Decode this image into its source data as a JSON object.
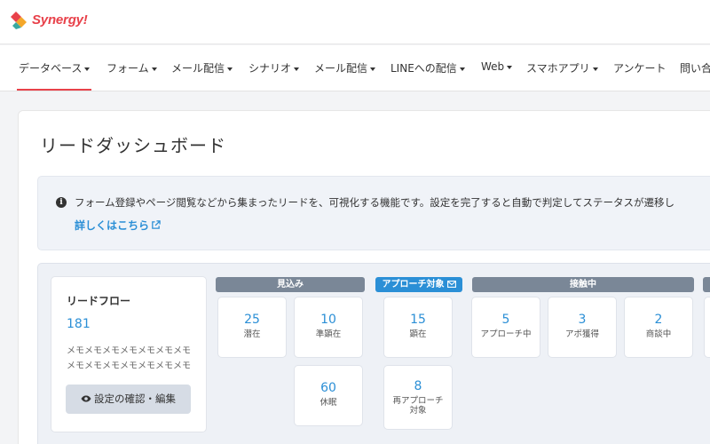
{
  "app": {
    "logo_text": "Synergy!"
  },
  "nav": {
    "items": [
      {
        "label": "データベース",
        "has_caret": true,
        "active": true
      },
      {
        "label": "フォーム",
        "has_caret": true
      },
      {
        "label": "メール配信",
        "has_caret": true
      },
      {
        "label": "シナリオ",
        "has_caret": true
      },
      {
        "label": "メール配信",
        "has_caret": true
      },
      {
        "label": "LINEへの配信",
        "has_caret": true
      },
      {
        "label": "Web",
        "has_caret": true
      },
      {
        "label": "スマホアプリ",
        "has_caret": true
      },
      {
        "label": "アンケート",
        "has_caret": false
      },
      {
        "label": "問い合",
        "has_caret": false
      }
    ]
  },
  "page": {
    "title": "リードダッシュボード"
  },
  "info": {
    "icon": "info-icon",
    "text": "フォーム登録やページ閲覧などから集まったリードを、可視化する機能です。設定を完了すると自動で判定してステータスが遷移し",
    "link_label": "詳しくはこちら",
    "link_icon": "external-link-icon"
  },
  "lead_flow": {
    "title": "リードフロー",
    "count": "181",
    "memo_line1": "メモメモメモメモメモメモメモ",
    "memo_line2": "メモメモメモメモメモメモメモ…",
    "button_label": "設定の確認・編集",
    "button_icon": "eye-icon"
  },
  "stages": [
    {
      "label": "見込み",
      "color": "#7a8797"
    },
    {
      "label": "アプローチ対象",
      "color": "#2b8fd6",
      "icon": "mail-icon"
    },
    {
      "label": "接触中",
      "color": "#7a8797"
    },
    {
      "label": "",
      "color": "#7a8797"
    }
  ],
  "statuses": {
    "senzai": {
      "count": "25",
      "label": "潜在"
    },
    "junkenzai": {
      "count": "10",
      "label": "準顕在"
    },
    "kyumin": {
      "count": "60",
      "label": "休眠"
    },
    "kenzai": {
      "count": "15",
      "label": "顕在"
    },
    "re_approach": {
      "count": "8",
      "label": "再アプローチ対象"
    },
    "approaching": {
      "count": "5",
      "label": "アプローチ中"
    },
    "appointment": {
      "count": "3",
      "label": "アポ獲得"
    },
    "negotiating": {
      "count": "2",
      "label": "商談中"
    }
  },
  "colors": {
    "accent": "#e8414a",
    "link": "#2b8fd6",
    "stage_gray": "#7a8797"
  }
}
